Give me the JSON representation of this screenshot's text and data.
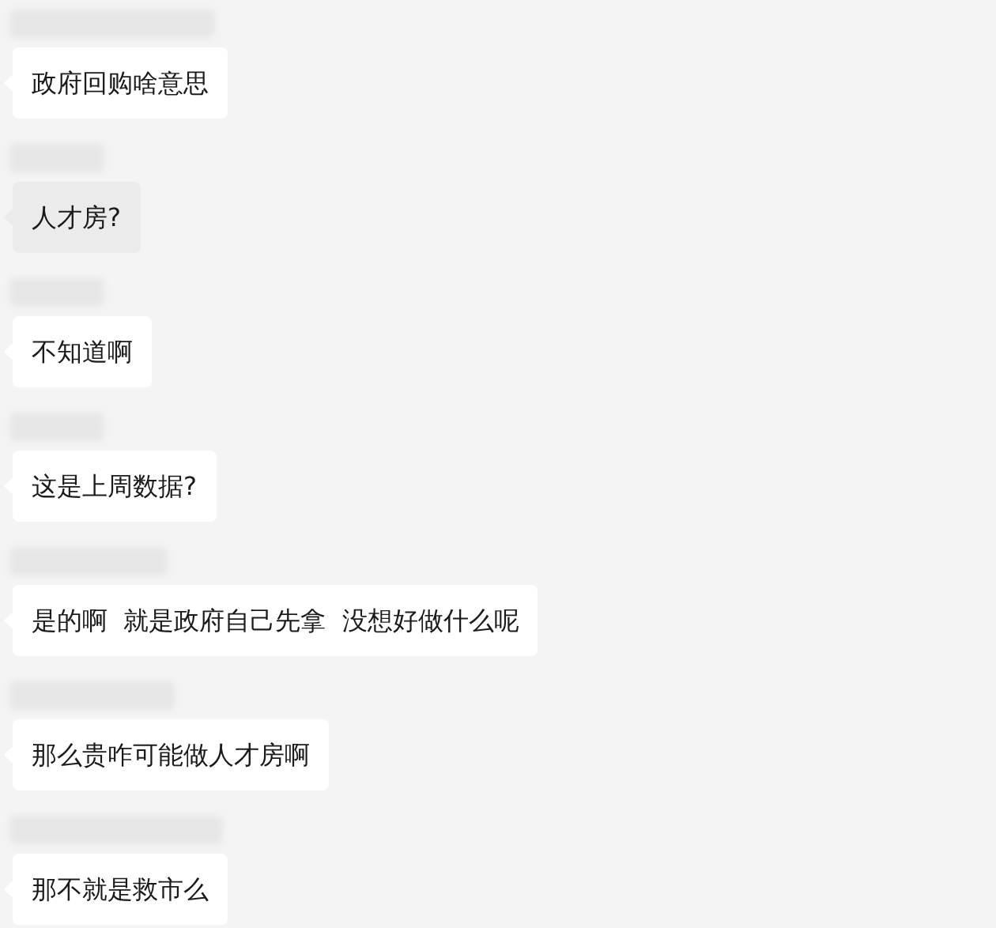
{
  "messages": [
    {
      "text": "政府回购啥意思",
      "selected": false
    },
    {
      "text": "人才房?",
      "selected": true
    },
    {
      "text": "不知道啊",
      "selected": false
    },
    {
      "text": "这是上周数据?",
      "selected": false
    },
    {
      "text": "是的啊  就是政府自己先拿  没想好做什么呢",
      "selected": false
    },
    {
      "text": "那么贵咋可能做人才房啊",
      "selected": false
    },
    {
      "text": "那不就是救市么",
      "selected": false
    }
  ]
}
